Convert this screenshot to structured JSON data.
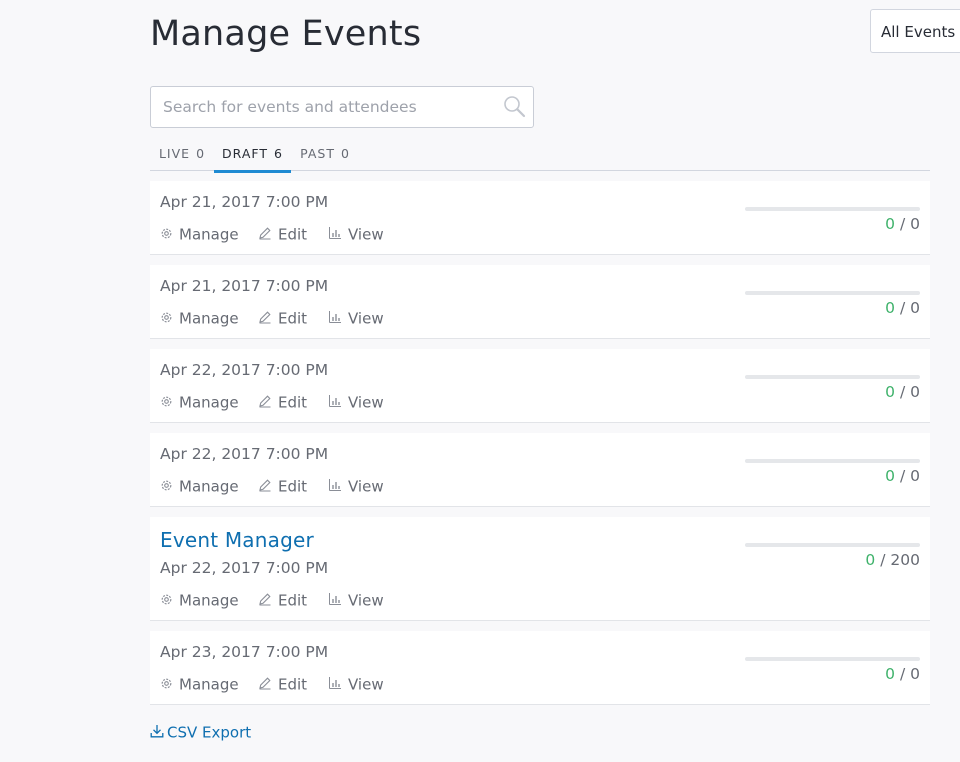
{
  "page_title": "Manage Events",
  "filter": {
    "selected": "All Events"
  },
  "search": {
    "placeholder": "Search for events and attendees",
    "value": ""
  },
  "tabs": [
    {
      "label": "LIVE",
      "count": "0",
      "active": false
    },
    {
      "label": "DRAFT",
      "count": "6",
      "active": true
    },
    {
      "label": "PAST",
      "count": "0",
      "active": false
    }
  ],
  "actions": {
    "manage": "Manage",
    "edit": "Edit",
    "view": "View"
  },
  "events": [
    {
      "name": "",
      "date": "Apr 21, 2017 7:00 PM",
      "sold": "0",
      "capacity": "0",
      "sold_fraction": 0
    },
    {
      "name": "",
      "date": "Apr 21, 2017 7:00 PM",
      "sold": "0",
      "capacity": "0",
      "sold_fraction": 0
    },
    {
      "name": "",
      "date": "Apr 22, 2017 7:00 PM",
      "sold": "0",
      "capacity": "0",
      "sold_fraction": 0
    },
    {
      "name": "",
      "date": "Apr 22, 2017 7:00 PM",
      "sold": "0",
      "capacity": "0",
      "sold_fraction": 0
    },
    {
      "name": "Event Manager",
      "date": "Apr 22, 2017 7:00 PM",
      "sold": "0",
      "capacity": "200",
      "sold_fraction": 0
    },
    {
      "name": "",
      "date": "Apr 23, 2017 7:00 PM",
      "sold": "0",
      "capacity": "0",
      "sold_fraction": 0
    }
  ],
  "ratio_separator": "/",
  "csv_export": {
    "label": "CSV Export"
  },
  "icons": {
    "search": "search-icon",
    "manage": "gear-icon",
    "edit": "pencil-icon",
    "view": "chart-icon",
    "export": "download-icon"
  },
  "colors": {
    "link": "#0f6fb0",
    "tab_active_underline": "#1e8ad2",
    "sold": "#3fb26b",
    "title": "#282c35",
    "text": "#666a73",
    "background": "#f8f8fa"
  }
}
